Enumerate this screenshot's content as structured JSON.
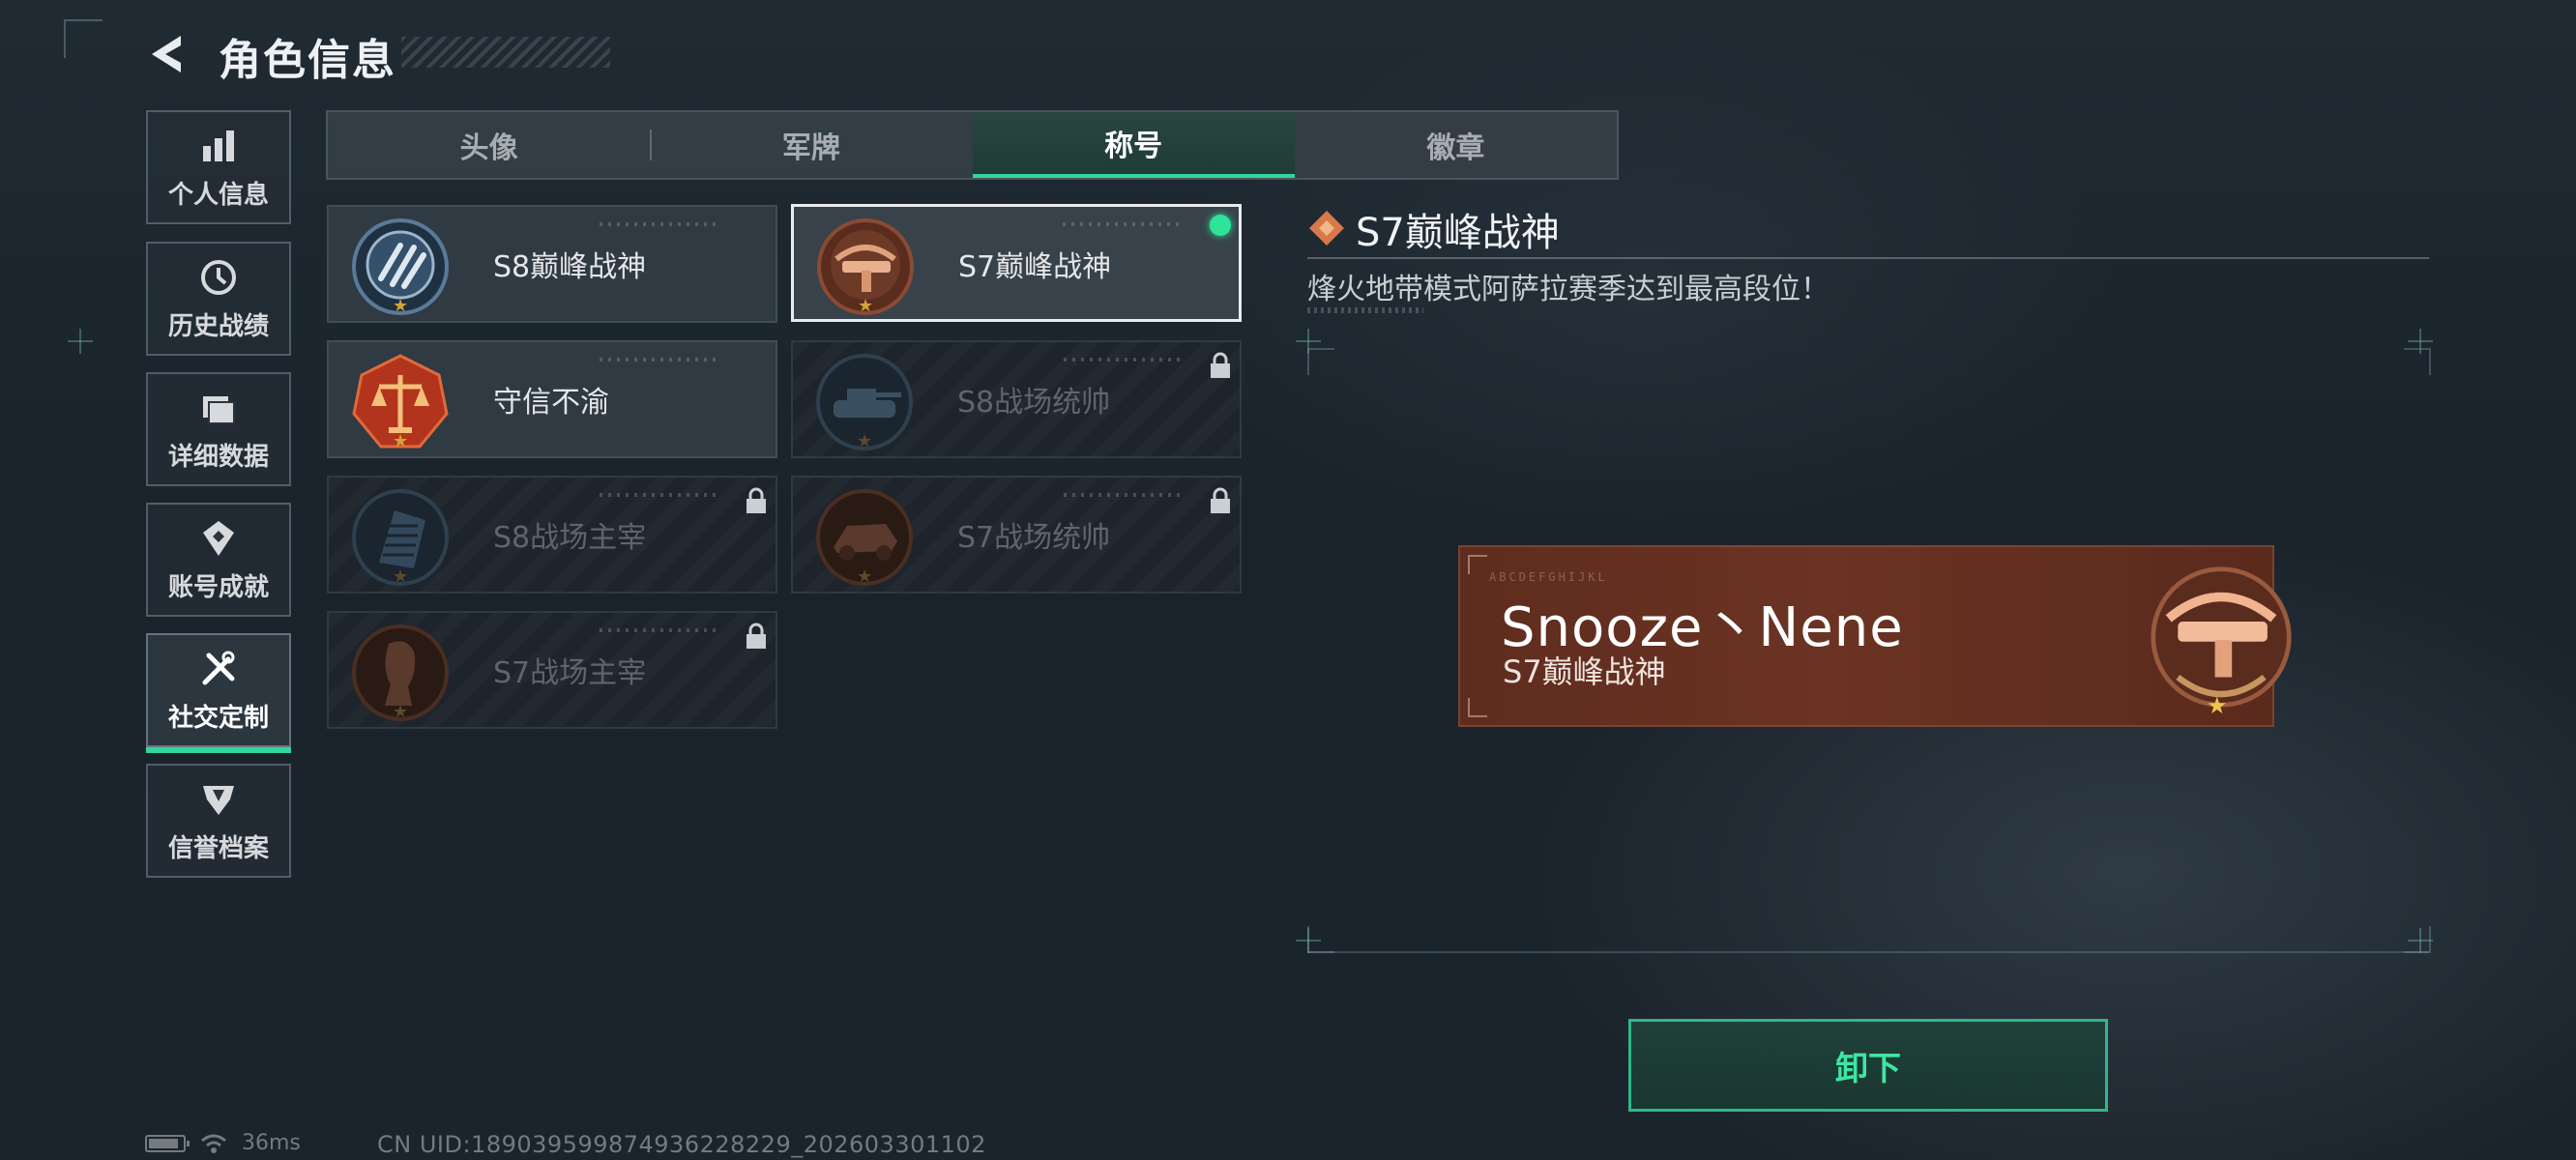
{
  "header": {
    "title": "角色信息"
  },
  "sidebar": {
    "items": [
      {
        "label": "个人信息",
        "icon": "bar-chart-icon"
      },
      {
        "label": "历史战绩",
        "icon": "clock-icon"
      },
      {
        "label": "详细数据",
        "icon": "folder-icon"
      },
      {
        "label": "账号成就",
        "icon": "achievement-icon"
      },
      {
        "label": "社交定制",
        "icon": "tools-icon",
        "active": true
      },
      {
        "label": "信誉档案",
        "icon": "reputation-icon"
      }
    ]
  },
  "tabs": [
    {
      "label": "头像"
    },
    {
      "label": "军牌"
    },
    {
      "label": "称号",
      "active": true
    },
    {
      "label": "徽章"
    }
  ],
  "titles": [
    {
      "name": "S8巅峰战神",
      "locked": false,
      "emblem": "s8-peak-emblem"
    },
    {
      "name": "S7巅峰战神",
      "locked": false,
      "selected": true,
      "equipped": true,
      "emblem": "s7-peak-crossbow-emblem"
    },
    {
      "name": "守信不渝",
      "locked": false,
      "emblem": "scales-emblem"
    },
    {
      "name": "S8战场统帅",
      "locked": true,
      "emblem": "tank-emblem"
    },
    {
      "name": "S8战场主宰",
      "locked": true,
      "emblem": "building-emblem"
    },
    {
      "name": "S7战场统帅",
      "locked": true,
      "emblem": "vehicle-emblem"
    },
    {
      "name": "S7战场主宰",
      "locked": true,
      "emblem": "soldier-emblem"
    }
  ],
  "detail": {
    "title": "S7巅峰战神",
    "description": "烽火地带模式阿萨拉赛季达到最高段位！"
  },
  "preview": {
    "code_text": "ABCDEFGHIJKL",
    "player_name": "Snooze丶Nene",
    "title": "S7巅峰战神"
  },
  "actions": {
    "unequip_label": "卸下"
  },
  "status": {
    "ping": "36ms",
    "uid": "CN UID:18903959987493622822​9_202603301102"
  },
  "colors": {
    "accent": "#33d69a",
    "equipped": "#2ee39a",
    "banner": "#6b3323"
  }
}
